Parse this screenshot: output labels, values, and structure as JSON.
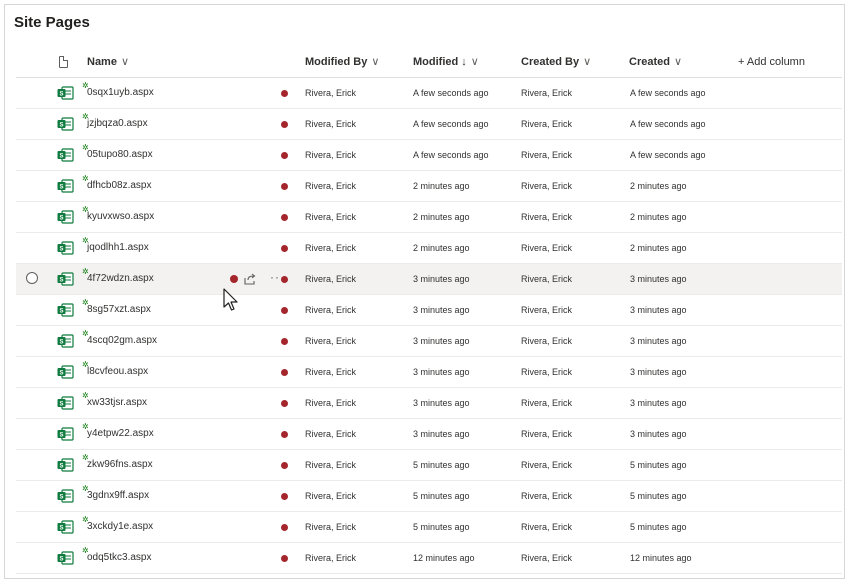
{
  "page": {
    "title": "Site Pages"
  },
  "columns": {
    "name": "Name",
    "modified_by": "Modified By",
    "modified": "Modified",
    "created_by": "Created By",
    "created": "Created",
    "add_column": "+ Add column",
    "sort_arrow": "↓",
    "chevron": "∨"
  },
  "icons": {
    "file_type_header": "document-icon",
    "page": "site-page-icon",
    "new_badge": "sparkle-icon",
    "checked_out": "checked-out-indicator-icon",
    "share": "share-icon",
    "more": "more-actions-icon",
    "cursor": "mouse-pointer-icon",
    "select": "radio-select-icon"
  },
  "colors": {
    "status_dot": "#a4262c",
    "page_icon": "#0f7b3f",
    "hover_row": "#f3f2f1"
  },
  "hover": {
    "more": "···"
  },
  "rows": [
    {
      "name": "0sqx1uyb.aspx",
      "modified_by": "Rivera, Erick",
      "modified": "A few seconds ago",
      "created_by": "Rivera, Erick",
      "created": "A few seconds ago"
    },
    {
      "name": "jzjbqza0.aspx",
      "modified_by": "Rivera, Erick",
      "modified": "A few seconds ago",
      "created_by": "Rivera, Erick",
      "created": "A few seconds ago"
    },
    {
      "name": "05tupo80.aspx",
      "modified_by": "Rivera, Erick",
      "modified": "A few seconds ago",
      "created_by": "Rivera, Erick",
      "created": "A few seconds ago"
    },
    {
      "name": "dfhcb08z.aspx",
      "modified_by": "Rivera, Erick",
      "modified": "2 minutes ago",
      "created_by": "Rivera, Erick",
      "created": "2 minutes ago"
    },
    {
      "name": "kyuvxwso.aspx",
      "modified_by": "Rivera, Erick",
      "modified": "2 minutes ago",
      "created_by": "Rivera, Erick",
      "created": "2 minutes ago"
    },
    {
      "name": "jqodlhh1.aspx",
      "modified_by": "Rivera, Erick",
      "modified": "2 minutes ago",
      "created_by": "Rivera, Erick",
      "created": "2 minutes ago"
    },
    {
      "name": "4f72wdzn.aspx",
      "modified_by": "Rivera, Erick",
      "modified": "3 minutes ago",
      "created_by": "Rivera, Erick",
      "created": "3 minutes ago",
      "hover": true
    },
    {
      "name": "8sg57xzt.aspx",
      "modified_by": "Rivera, Erick",
      "modified": "3 minutes ago",
      "created_by": "Rivera, Erick",
      "created": "3 minutes ago"
    },
    {
      "name": "4scq02gm.aspx",
      "modified_by": "Rivera, Erick",
      "modified": "3 minutes ago",
      "created_by": "Rivera, Erick",
      "created": "3 minutes ago"
    },
    {
      "name": "l8cvfeou.aspx",
      "modified_by": "Rivera, Erick",
      "modified": "3 minutes ago",
      "created_by": "Rivera, Erick",
      "created": "3 minutes ago"
    },
    {
      "name": "xw33tjsr.aspx",
      "modified_by": "Rivera, Erick",
      "modified": "3 minutes ago",
      "created_by": "Rivera, Erick",
      "created": "3 minutes ago"
    },
    {
      "name": "y4etpw22.aspx",
      "modified_by": "Rivera, Erick",
      "modified": "3 minutes ago",
      "created_by": "Rivera, Erick",
      "created": "3 minutes ago"
    },
    {
      "name": "zkw96fns.aspx",
      "modified_by": "Rivera, Erick",
      "modified": "5 minutes ago",
      "created_by": "Rivera, Erick",
      "created": "5 minutes ago"
    },
    {
      "name": "3gdnx9ff.aspx",
      "modified_by": "Rivera, Erick",
      "modified": "5 minutes ago",
      "created_by": "Rivera, Erick",
      "created": "5 minutes ago"
    },
    {
      "name": "3xckdy1e.aspx",
      "modified_by": "Rivera, Erick",
      "modified": "5 minutes ago",
      "created_by": "Rivera, Erick",
      "created": "5 minutes ago"
    },
    {
      "name": "odq5tkc3.aspx",
      "modified_by": "Rivera, Erick",
      "modified": "12 minutes ago",
      "created_by": "Rivera, Erick",
      "created": "12 minutes ago"
    }
  ]
}
